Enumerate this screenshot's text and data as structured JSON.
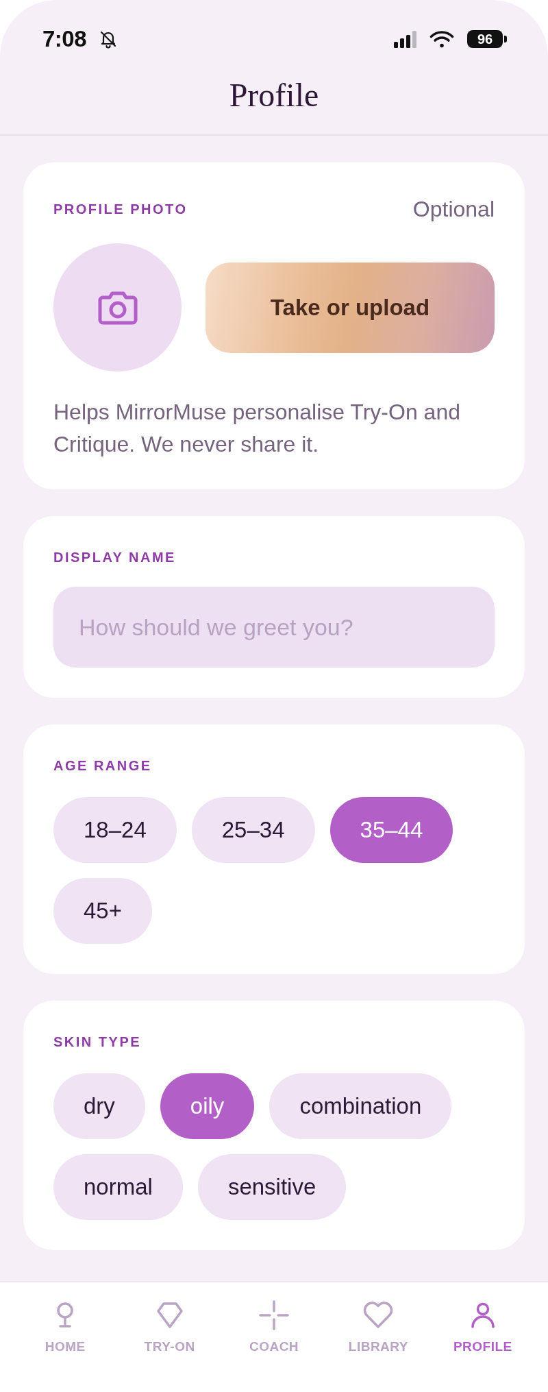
{
  "status_bar": {
    "time": "7:08",
    "battery": "96"
  },
  "header": {
    "title": "Profile"
  },
  "profile_photo": {
    "label": "PROFILE PHOTO",
    "note": "Optional",
    "button": "Take or upload",
    "description": "Helps MirrorMuse personalise Try-On and Critique. We never share it."
  },
  "display_name": {
    "label": "DISPLAY NAME",
    "placeholder": "How should we greet you?"
  },
  "age_range": {
    "label": "AGE RANGE",
    "options": [
      {
        "label": "18–24",
        "selected": false
      },
      {
        "label": "25–34",
        "selected": false
      },
      {
        "label": "35–44",
        "selected": true
      },
      {
        "label": "45+",
        "selected": false
      }
    ]
  },
  "skin_type": {
    "label": "SKIN TYPE",
    "options": [
      {
        "label": "dry",
        "selected": false
      },
      {
        "label": "oily",
        "selected": true
      },
      {
        "label": "combination",
        "selected": false
      },
      {
        "label": "normal",
        "selected": false
      },
      {
        "label": "sensitive",
        "selected": false
      }
    ]
  },
  "tab_bar": {
    "tabs": [
      {
        "label": "HOME",
        "selected": false
      },
      {
        "label": "TRY-ON",
        "selected": false
      },
      {
        "label": "COACH",
        "selected": false
      },
      {
        "label": "LIBRARY",
        "selected": false
      },
      {
        "label": "PROFILE",
        "selected": true
      }
    ]
  }
}
